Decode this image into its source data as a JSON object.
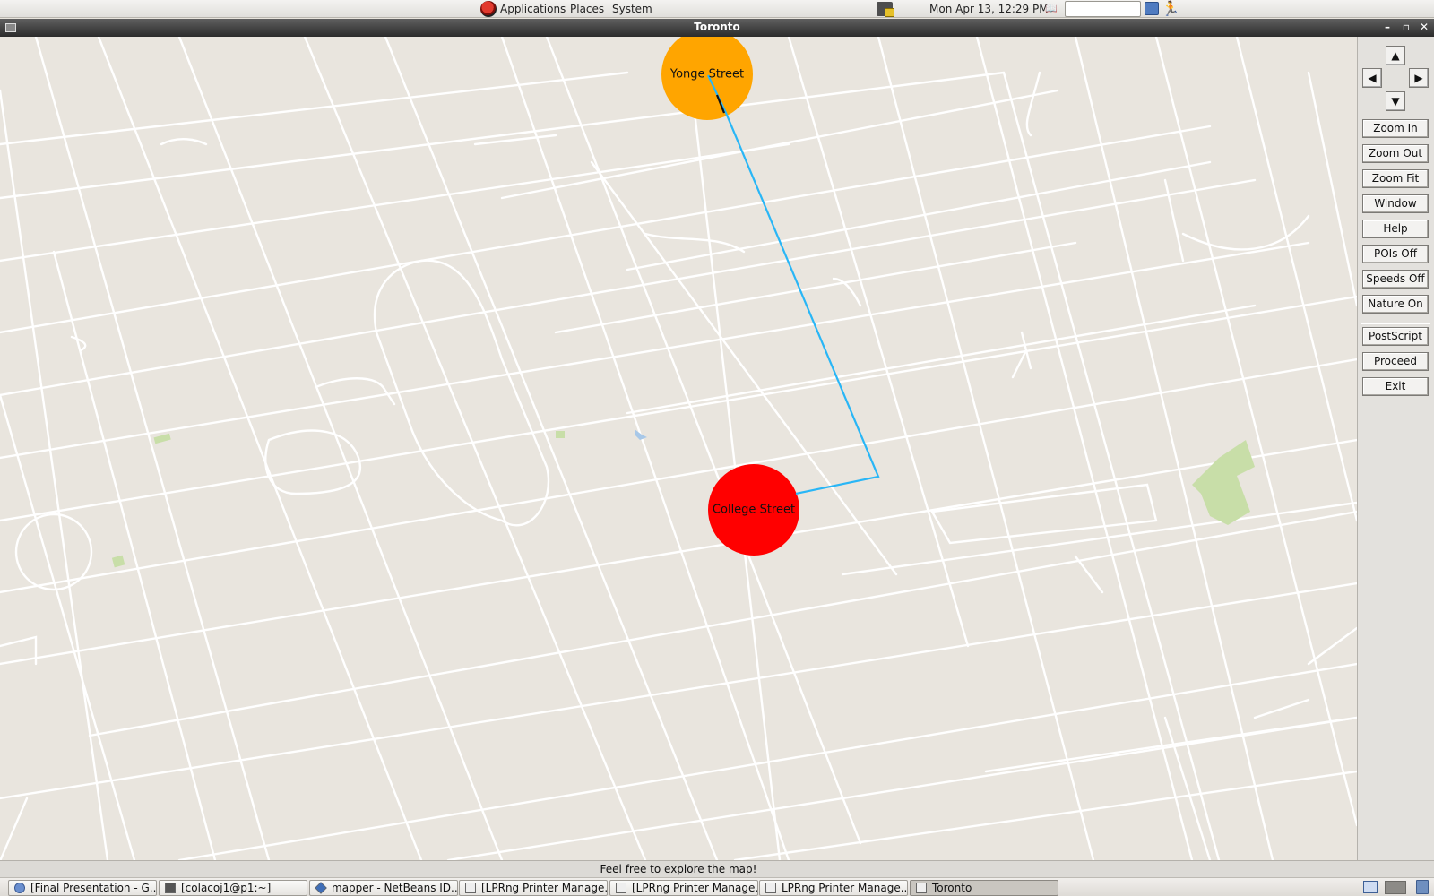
{
  "top_panel": {
    "menus": [
      "Applications",
      "Places",
      "System"
    ],
    "clock": "Mon Apr 13, 12:29 PM",
    "search_value": ""
  },
  "window": {
    "title": "Toronto"
  },
  "map": {
    "markers": [
      {
        "label": "Yonge Street",
        "color": "#ffa500",
        "role": "start"
      },
      {
        "label": "College Street",
        "color": "#ff0000",
        "role": "destination"
      }
    ],
    "route_color": "#29b6f6",
    "features": {
      "roads": "#ffffff",
      "parks": "#c8dea8",
      "water": "#a8c8e8",
      "background": "#e9e5de"
    }
  },
  "controls": {
    "pan": {
      "up": "▲",
      "left": "◀",
      "right": "▶",
      "down": "▼"
    },
    "buttons": [
      "Zoom In",
      "Zoom Out",
      "Zoom Fit",
      "Window",
      "Help",
      "POIs Off",
      "Speeds Off",
      "Nature On",
      "PostScript",
      "Proceed",
      "Exit"
    ]
  },
  "status": {
    "message": "Feel free to explore the map!"
  },
  "taskbar": {
    "tasks": [
      "[Final Presentation - G...",
      "[colacoj1@p1:~]",
      "mapper - NetBeans ID...",
      "[LPRng Printer Manage...",
      "[LPRng Printer Manage...",
      "LPRng Printer Manage...",
      "Toronto"
    ],
    "active_task": "Toronto"
  }
}
